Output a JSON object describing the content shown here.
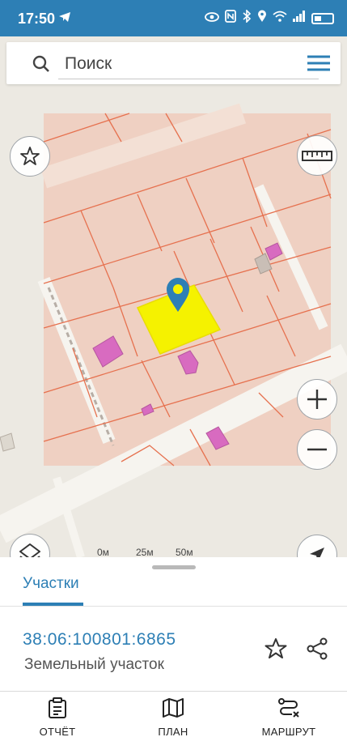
{
  "status_bar": {
    "time": "17:50"
  },
  "search": {
    "placeholder": "Поиск"
  },
  "map": {
    "scale": {
      "labels": [
        "0м",
        "25м",
        "50м"
      ]
    }
  },
  "sheet": {
    "tab_label": "Участки",
    "parcel": {
      "number": "38:06:100801:6865",
      "type": "Земельный участок"
    }
  },
  "bottom_nav": {
    "report": "ОТЧЁТ",
    "plan": "ПЛАН",
    "route": "МАРШРУТ"
  },
  "colors": {
    "accent": "#2d7fb5",
    "parcel_highlight": "#f5f200",
    "parcel_fill": "#efcfc3",
    "parcel_border": "#e6714f",
    "building": "#d86bc0"
  }
}
